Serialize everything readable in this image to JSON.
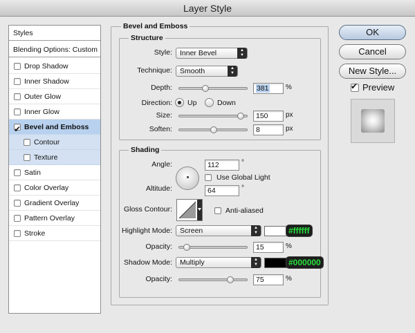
{
  "window": {
    "title": "Layer Style"
  },
  "styles_list": {
    "header": "Styles",
    "blending": "Blending Options: Custom",
    "items": [
      {
        "label": "Drop Shadow",
        "checked": false
      },
      {
        "label": "Inner Shadow",
        "checked": false
      },
      {
        "label": "Outer Glow",
        "checked": false
      },
      {
        "label": "Inner Glow",
        "checked": false
      },
      {
        "label": "Bevel and Emboss",
        "checked": true
      },
      {
        "label": "Contour",
        "checked": false
      },
      {
        "label": "Texture",
        "checked": false
      },
      {
        "label": "Satin",
        "checked": false
      },
      {
        "label": "Color Overlay",
        "checked": false
      },
      {
        "label": "Gradient Overlay",
        "checked": false
      },
      {
        "label": "Pattern Overlay",
        "checked": false
      },
      {
        "label": "Stroke",
        "checked": false
      }
    ]
  },
  "panel": {
    "title": "Bevel and Emboss",
    "structure": {
      "title": "Structure",
      "style_label": "Style:",
      "style_value": "Inner Bevel",
      "technique_label": "Technique:",
      "technique_value": "Smooth",
      "depth_label": "Depth:",
      "depth_value": "381",
      "depth_unit": "%",
      "direction_label": "Direction:",
      "direction_up": "Up",
      "direction_down": "Down",
      "size_label": "Size:",
      "size_value": "150",
      "size_unit": "px",
      "soften_label": "Soften:",
      "soften_value": "8",
      "soften_unit": "px"
    },
    "shading": {
      "title": "Shading",
      "angle_label": "Angle:",
      "angle_value": "112",
      "angle_unit": "°",
      "global_light_label": "Use Global Light",
      "altitude_label": "Altitude:",
      "altitude_value": "64",
      "altitude_unit": "°",
      "gloss_label": "Gloss Contour:",
      "anti_aliased_label": "Anti-aliased",
      "highlight_label": "Highlight Mode:",
      "highlight_value": "Screen",
      "highlight_color": "#ffffff",
      "highlight_hex": "#ffffff",
      "highlight_opacity_label": "Opacity:",
      "highlight_opacity_value": "15",
      "highlight_opacity_unit": "%",
      "shadow_label": "Shadow Mode:",
      "shadow_value": "Multiply",
      "shadow_color": "#000000",
      "shadow_hex": "#000000",
      "shadow_opacity_label": "Opacity:",
      "shadow_opacity_value": "75",
      "shadow_opacity_unit": "%"
    }
  },
  "buttons": {
    "ok": "OK",
    "cancel": "Cancel",
    "new_style": "New Style...",
    "preview": "Preview"
  },
  "accent": "#27e03c"
}
